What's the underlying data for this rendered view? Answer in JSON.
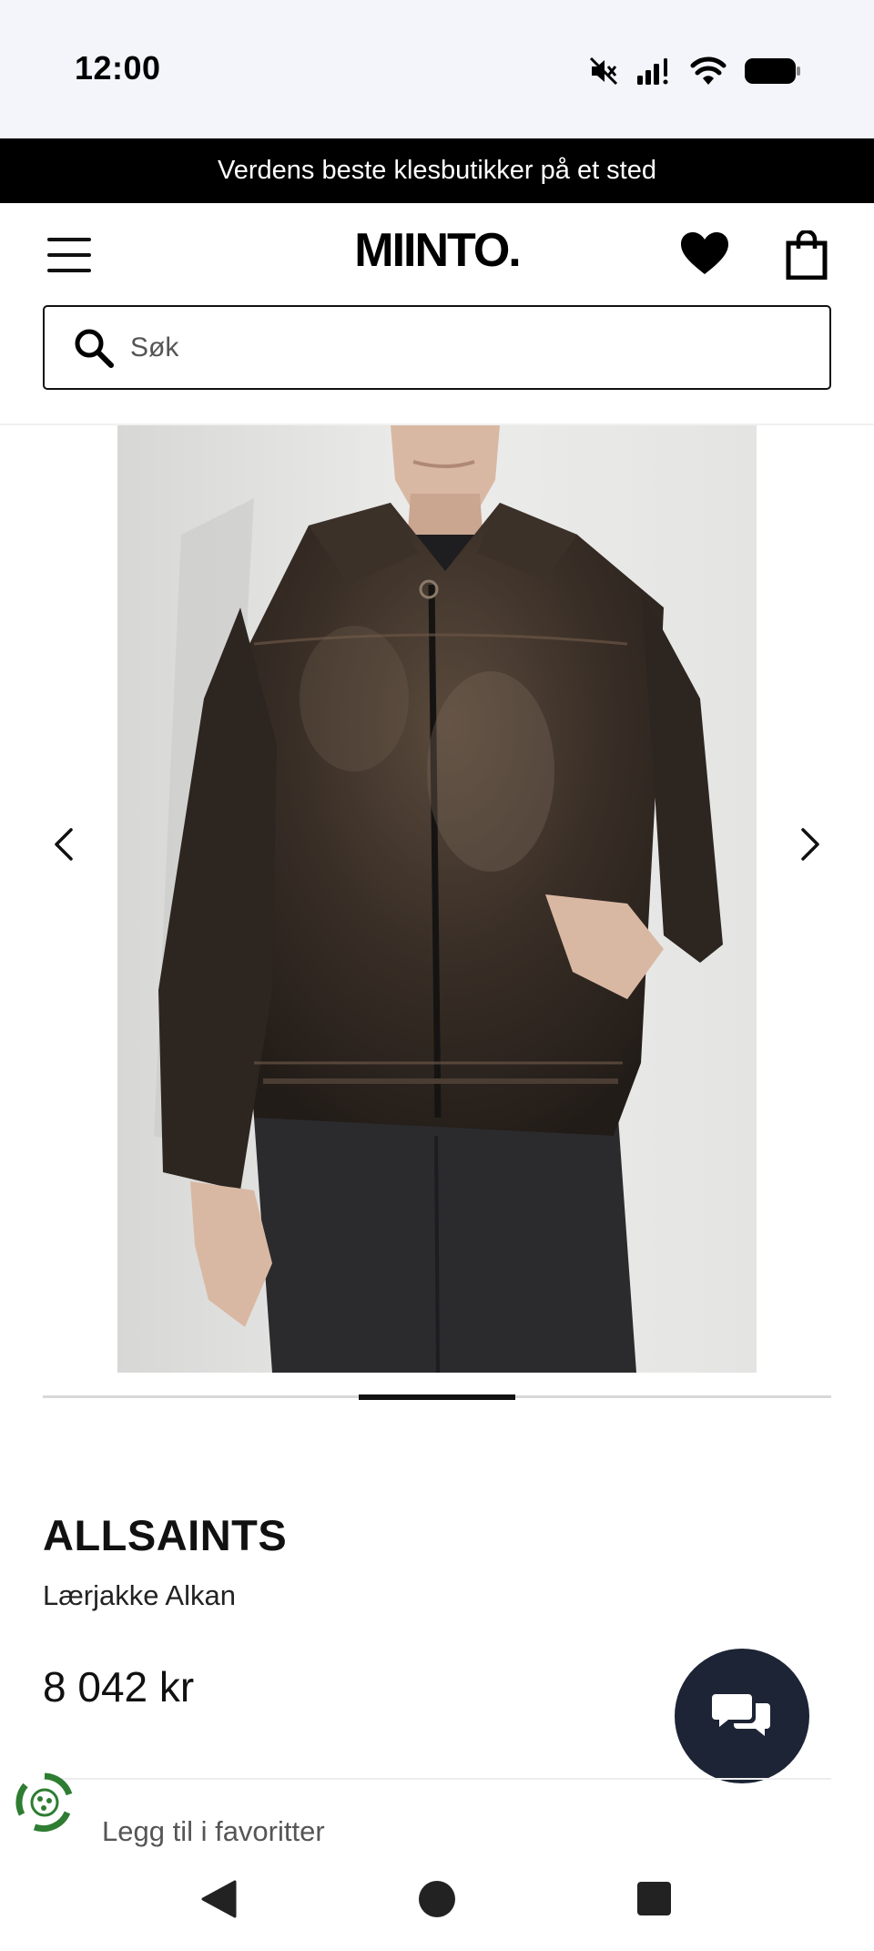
{
  "status_bar": {
    "time": "12:00",
    "icons": [
      "mute-icon",
      "signal-icon",
      "wifi-icon",
      "battery-icon"
    ]
  },
  "promo": {
    "text": "Verdens beste klesbutikker på et sted"
  },
  "header": {
    "logo": "MIINTO.",
    "icons": [
      "menu-icon",
      "heart-icon",
      "bag-icon"
    ]
  },
  "search": {
    "placeholder": "Søk",
    "value": ""
  },
  "gallery": {
    "current_slide": 3,
    "total_slides": 5
  },
  "product": {
    "brand": "ALLSAINTS",
    "name": "Lærjakke Alkan",
    "price": "8 042 kr"
  },
  "actions": {
    "add_to_favorites": "Legg til i favoritter"
  },
  "colors": {
    "promo_bg": "#000000",
    "chat_bg": "#1c2435",
    "eco_green": "#2e7d32"
  }
}
